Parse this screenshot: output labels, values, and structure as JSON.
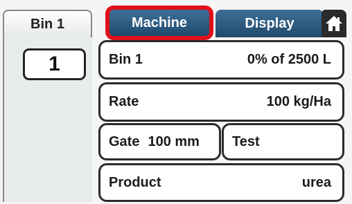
{
  "left_tab": {
    "label": "Bin 1"
  },
  "bin_indicator": {
    "value": "1"
  },
  "tabs": [
    {
      "label": "Machine",
      "selected": true
    },
    {
      "label": "Display",
      "selected": false
    }
  ],
  "home": {
    "icon": "home-icon"
  },
  "rows": {
    "bin": {
      "label": "Bin 1",
      "value": "0% of 2500 L"
    },
    "rate": {
      "label": "Rate",
      "value": "100 kg/Ha"
    },
    "gate": {
      "label": "Gate",
      "value": "100 mm"
    },
    "test": {
      "label": "Test"
    },
    "product": {
      "label": "Product",
      "value": "urea"
    }
  },
  "colors": {
    "tab_blue": "#2a577c",
    "highlight_red": "#e0101a",
    "border": "#2a2a2a"
  }
}
